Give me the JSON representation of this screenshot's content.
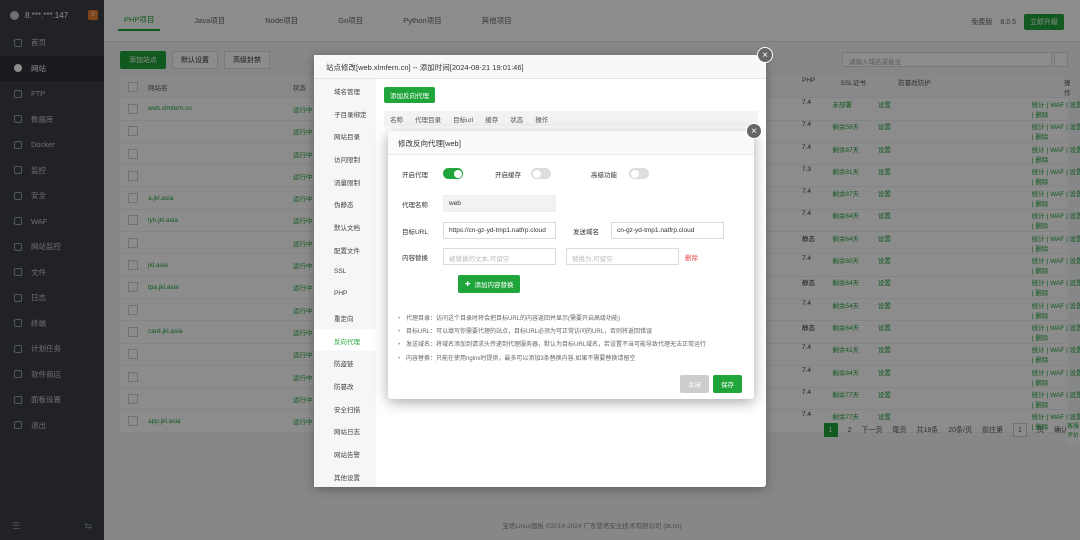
{
  "sidebar": {
    "server": "8.***.***.147",
    "badge": "0",
    "items": [
      {
        "label": "首页",
        "icon": "home-icon"
      },
      {
        "label": "网站",
        "icon": "globe-icon"
      },
      {
        "label": "FTP",
        "icon": "ftp-icon"
      },
      {
        "label": "数据库",
        "icon": "database-icon"
      },
      {
        "label": "Docker",
        "icon": "docker-icon"
      },
      {
        "label": "监控",
        "icon": "monitor-icon"
      },
      {
        "label": "安全",
        "icon": "shield-icon"
      },
      {
        "label": "WAF",
        "icon": "waf-icon"
      },
      {
        "label": "网站监控",
        "icon": "chart-icon"
      },
      {
        "label": "文件",
        "icon": "folder-icon"
      },
      {
        "label": "日志",
        "icon": "log-icon"
      },
      {
        "label": "终端",
        "icon": "terminal-icon"
      },
      {
        "label": "计划任务",
        "icon": "clock-icon"
      },
      {
        "label": "软件商店",
        "icon": "store-icon"
      },
      {
        "label": "面板设置",
        "icon": "settings-icon"
      },
      {
        "label": "退出",
        "icon": "logout-icon"
      }
    ],
    "footer_left": "☰",
    "footer_right": "⇆"
  },
  "tabs": [
    "PHP项目",
    "Java项目",
    "Node项目",
    "Go项目",
    "Python项目",
    "其他项目"
  ],
  "top_right": {
    "user": "免费版",
    "version": "8.0.5",
    "upgrade": "立即升级"
  },
  "toolbar": {
    "add_site": "添加站点",
    "default_page": "默认设置",
    "recycle": "高级封禁"
  },
  "search": {
    "placeholder": "请输入域名或备注"
  },
  "table": {
    "headers": {
      "name": "网站名",
      "status": "状态",
      "php": "PHP",
      "ssl": "SSL证书",
      "protect": "防篡改防护",
      "ops": "操作"
    },
    "rows": [
      {
        "name": "web.xlmfern.cn",
        "status": "运行中",
        "php": "7.4",
        "ssl": "未部署",
        "protect": "设置",
        "ops": "统计 | WAF | 设置 | 删除"
      },
      {
        "name": "",
        "status": "运行中",
        "php": "7.4",
        "ssl": "剩余58天",
        "protect": "设置",
        "ops": "统计 | WAF | 设置 | 删除"
      },
      {
        "name": "",
        "status": "运行中",
        "php": "7.4",
        "ssl": "剩余87天",
        "protect": "设置",
        "ops": "统计 | WAF | 设置 | 删除"
      },
      {
        "name": "",
        "status": "运行中",
        "php": "7.3",
        "ssl": "剩余81天",
        "protect": "设置",
        "ops": "统计 | WAF | 设置 | 删除"
      },
      {
        "name": "a.jkl.asia",
        "status": "运行中",
        "php": "7.4",
        "ssl": "剩余87天",
        "protect": "设置",
        "ops": "统计 | WAF | 设置 | 删除"
      },
      {
        "name": "lyh.jkl.asia",
        "status": "运行中",
        "php": "7.4",
        "ssl": "剩余64天",
        "protect": "设置",
        "ops": "统计 | WAF | 设置 | 删除"
      },
      {
        "name": "",
        "status": "运行中",
        "php": "静态",
        "ssl": "剩余64天",
        "protect": "设置",
        "ops": "统计 | WAF | 设置 | 删除"
      },
      {
        "name": "jkl.asia",
        "status": "运行中",
        "php": "7.4",
        "ssl": "剩余60天",
        "protect": "设置",
        "ops": "统计 | WAF | 设置 | 删除"
      },
      {
        "name": "tpa.jkl.asia",
        "status": "运行中",
        "php": "静态",
        "ssl": "剩余64天",
        "protect": "设置",
        "ops": "统计 | WAF | 设置 | 删除"
      },
      {
        "name": "",
        "status": "运行中",
        "php": "7.4",
        "ssl": "剩余54天",
        "protect": "设置",
        "ops": "统计 | WAF | 设置 | 删除"
      },
      {
        "name": "card.jkl.asia",
        "status": "运行中",
        "php": "静态",
        "ssl": "剩余64天",
        "protect": "设置",
        "ops": "统计 | WAF | 设置 | 删除"
      },
      {
        "name": "",
        "status": "运行中",
        "php": "7.4",
        "ssl": "剩余41天",
        "protect": "设置",
        "ops": "统计 | WAF | 设置 | 删除"
      },
      {
        "name": "",
        "status": "运行中",
        "php": "7.4",
        "ssl": "剩余84天",
        "protect": "设置",
        "ops": "统计 | WAF | 设置 | 删除"
      },
      {
        "name": "",
        "status": "运行中",
        "php": "7.4",
        "ssl": "剩余77天",
        "protect": "设置",
        "ops": "统计 | WAF | 设置 | 删除"
      },
      {
        "name": "app.jkl.asia",
        "status": "运行中",
        "php": "7.4",
        "ssl": "剩余77天",
        "protect": "设置",
        "ops": "统计 | WAF | 设置 | 删除"
      }
    ]
  },
  "pager": {
    "current": "1",
    "next_page": "2",
    "next": "下一页",
    "last": "尾页",
    "total": "共18条",
    "per_page": "20条/页",
    "goto": "前往第",
    "page_num": "1",
    "page_unit": "页",
    "confirm": "确认"
  },
  "footer": "宝塔Linux面板 ©2014-2024 广东堡塔安全技术有限公司 (bt.cn)",
  "feedback": [
    "客服",
    "评价"
  ],
  "site_dialog": {
    "title": "站点修改[web.xlmfern.cn] -- 添加时间[2024-08-21 19:01:46]",
    "menu": [
      "域名管理",
      "子目录绑定",
      "网站目录",
      "访问限制",
      "流量限制",
      "伪静态",
      "默认文档",
      "配置文件",
      "SSL",
      "PHP",
      "重定向",
      "反向代理",
      "防盗链",
      "防篡改",
      "安全扫描",
      "网站日志",
      "网站告警",
      "其他设置"
    ],
    "active_menu": "反向代理",
    "add_proxy": "添加反向代理",
    "proxy_cols": [
      "名称",
      "代理目录",
      "目标url",
      "缓存",
      "状态",
      "操作"
    ]
  },
  "proxy_dialog": {
    "title": "修改反向代理[web]",
    "enable_proxy": "开启代理",
    "enable_cache": "开启缓存",
    "advanced": "高级功能",
    "proxy_name_label": "代理名称",
    "proxy_name": "web",
    "target_url_label": "目标URL",
    "target_url": "https://cn-gz-yd-tmp1.natfrp.cloud",
    "send_domain_label": "发送域名",
    "send_domain": "cn-gz-yd-tmp1.natfrp.cloud",
    "content_replace_label": "内容替换",
    "replace_from_placeholder": "被替换的文本,可留空",
    "replace_to_placeholder": "替换为,可留空",
    "delete": "删除",
    "add_rule": "添加内容替换",
    "tips": [
      "代理目录：访问这个目录时将会把目标URL的内容返回并显示(需要开启高级功能)",
      "目标URL：可以填写你需要代理的站点，目标URL必须为可正常访问的URL，否则将返回错误",
      "发送域名：将域名添加到请求头传递到代理服务器，默认为目标URL域名，若设置不当可能导致代理无法正常运行",
      "内容替换：只能在使用nginx时提供，最多可以添加3条替换内容,如果不需要替换请留空"
    ],
    "cancel": "关闭",
    "save": "保存"
  }
}
